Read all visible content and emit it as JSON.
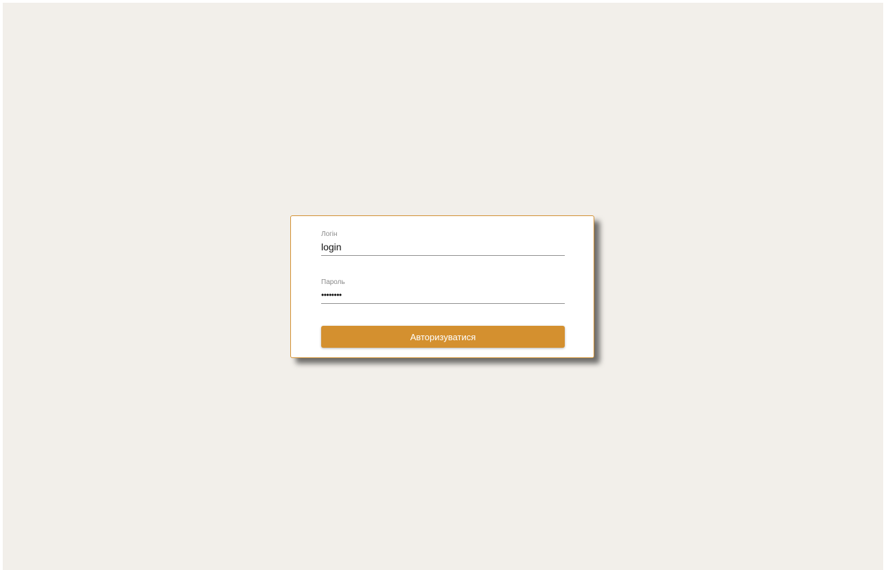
{
  "colors": {
    "background": "#f2efea",
    "card_border": "#d39031",
    "accent": "#d4902f",
    "button_text": "#ffffff"
  },
  "login_form": {
    "login_field": {
      "label": "Логін",
      "value": "login"
    },
    "password_field": {
      "label": "Пароль",
      "value": "••••••••"
    },
    "submit_label": "Авторизуватися"
  }
}
